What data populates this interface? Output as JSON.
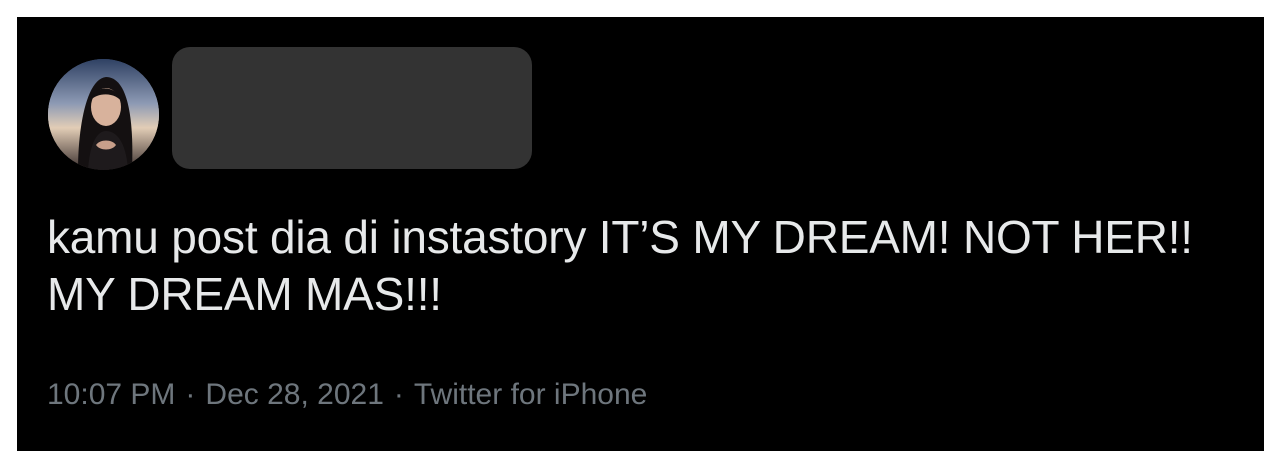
{
  "tweet": {
    "text": "kamu post dia di instastory IT’S MY DREAM! NOT HER!! MY DREAM MAS!!!",
    "time": "10:07 PM",
    "separator": "·",
    "date": "Dec 28, 2021",
    "source": "Twitter for iPhone"
  },
  "colors": {
    "background": "#000000",
    "text": "#e7e9ea",
    "meta": "#6e767d",
    "redaction": "#333333"
  },
  "icons": {
    "avatar": "profile-photo"
  }
}
